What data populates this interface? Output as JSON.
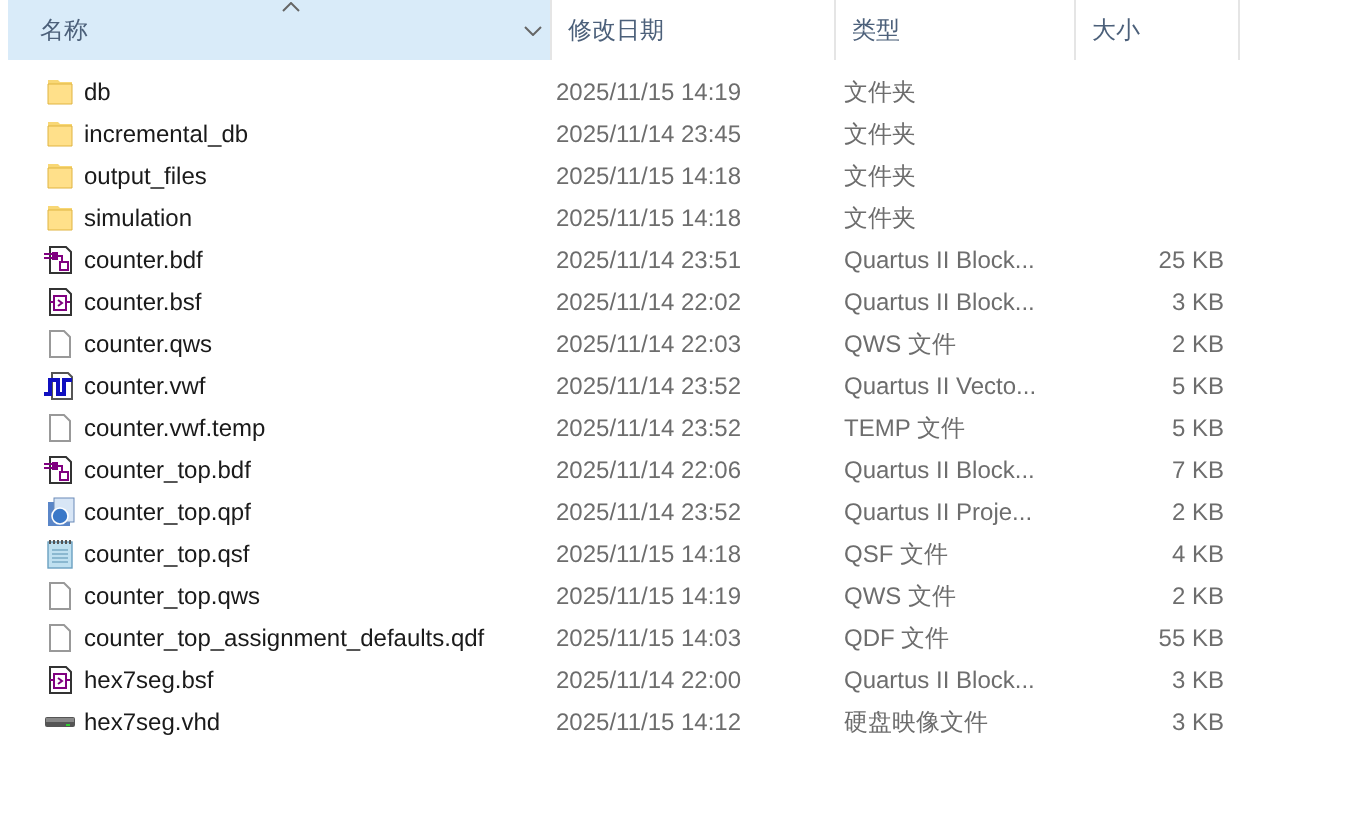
{
  "columns": [
    {
      "label": "名称",
      "sorted": true
    },
    {
      "label": "修改日期",
      "sorted": false
    },
    {
      "label": "类型",
      "sorted": false
    },
    {
      "label": "大小",
      "sorted": false
    }
  ],
  "files": [
    {
      "kind": "folder",
      "name": "db",
      "modified": "2025/11/15 14:19",
      "type": "文件夹"
    },
    {
      "kind": "folder",
      "name": "incremental_db",
      "modified": "2025/11/14 23:45",
      "type": "文件夹"
    },
    {
      "kind": "folder",
      "name": "output_files",
      "modified": "2025/11/15 14:18",
      "type": "文件夹"
    },
    {
      "kind": "folder",
      "name": "simulation",
      "modified": "2025/11/15 14:18",
      "type": "文件夹"
    },
    {
      "kind": "bdf",
      "name": "counter.bdf",
      "modified": "2025/11/14 23:51",
      "type": "Quartus II Block...",
      "size": "25 KB"
    },
    {
      "kind": "bsf",
      "name": "counter.bsf",
      "modified": "2025/11/14 22:02",
      "type": "Quartus II Block...",
      "size": "3 KB"
    },
    {
      "kind": "blank",
      "name": "counter.qws",
      "modified": "2025/11/14 22:03",
      "type": "QWS 文件",
      "size": "2 KB"
    },
    {
      "kind": "vwf",
      "name": "counter.vwf",
      "modified": "2025/11/14 23:52",
      "type": "Quartus II Vecto...",
      "size": "5 KB"
    },
    {
      "kind": "blank",
      "name": "counter.vwf.temp",
      "modified": "2025/11/14 23:52",
      "type": "TEMP 文件",
      "size": "5 KB"
    },
    {
      "kind": "bdf",
      "name": "counter_top.bdf",
      "modified": "2025/11/14 22:06",
      "type": "Quartus II Block...",
      "size": "7 KB"
    },
    {
      "kind": "qpf",
      "name": "counter_top.qpf",
      "modified": "2025/11/14 23:52",
      "type": "Quartus II Proje...",
      "size": "2 KB"
    },
    {
      "kind": "qsf",
      "name": "counter_top.qsf",
      "modified": "2025/11/15 14:18",
      "type": "QSF 文件",
      "size": "4 KB"
    },
    {
      "kind": "blank",
      "name": "counter_top.qws",
      "modified": "2025/11/15 14:19",
      "type": "QWS 文件",
      "size": "2 KB"
    },
    {
      "kind": "blank",
      "name": "counter_top_assignment_defaults.qdf",
      "modified": "2025/11/15 14:03",
      "type": "QDF 文件",
      "size": "55 KB"
    },
    {
      "kind": "bsf",
      "name": "hex7seg.bsf",
      "modified": "2025/11/14 22:00",
      "type": "Quartus II Block...",
      "size": "3 KB"
    },
    {
      "kind": "vhd",
      "name": "hex7seg.vhd",
      "modified": "2025/11/15 14:12",
      "type": "硬盘映像文件",
      "size": "3 KB"
    }
  ]
}
